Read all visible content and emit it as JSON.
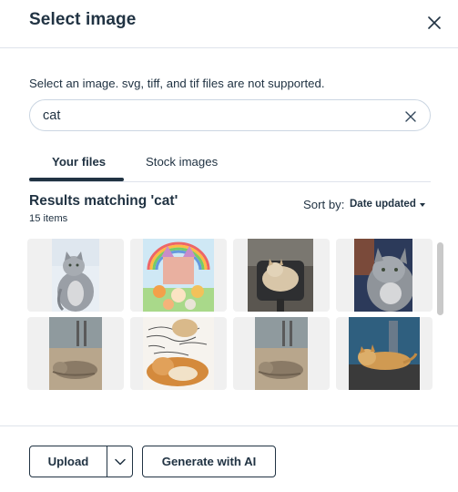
{
  "dialog": {
    "title": "Select image",
    "instructions": "Select an image. svg, tiff, and tif files are not supported."
  },
  "search": {
    "value": "cat",
    "placeholder": ""
  },
  "tabs": [
    {
      "label": "Your files",
      "active": true
    },
    {
      "label": "Stock images",
      "active": false
    }
  ],
  "results": {
    "heading": "Results matching 'cat'",
    "count": "15 items",
    "sort_label": "Sort by:",
    "sort_value": "Date updated"
  },
  "images": [
    {
      "subject": "gray long-haired cat sitting"
    },
    {
      "subject": "cartoon cats with rainbow castle"
    },
    {
      "subject": "cat lying on office chair"
    },
    {
      "subject": "gray cat close-up by wall"
    },
    {
      "subject": "tabby cat lying on floor"
    },
    {
      "subject": "cat with handwritten letters"
    },
    {
      "subject": "tabby cat lying on floor"
    },
    {
      "subject": "orange cat lying on blue shelf"
    }
  ],
  "footer": {
    "upload_label": "Upload",
    "generate_label": "Generate with AI"
  },
  "colors": {
    "text": "#213343",
    "border": "#dfe3eb",
    "tile_bg": "#f0f0f0"
  }
}
